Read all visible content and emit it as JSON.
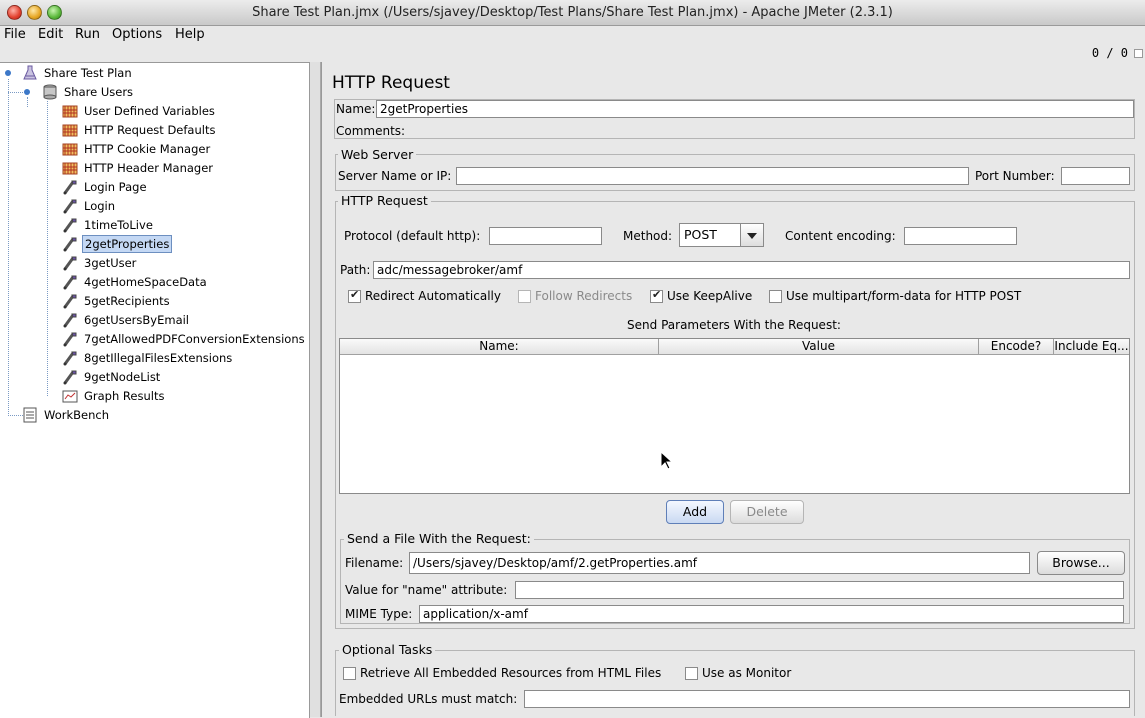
{
  "window": {
    "title": "Share Test Plan.jmx (/Users/sjavey/Desktop/Test Plans/Share Test Plan.jmx) - Apache JMeter (2.3.1)"
  },
  "menu": [
    "File",
    "Edit",
    "Run",
    "Options",
    "Help"
  ],
  "status": {
    "counter": "0 / 0"
  },
  "tree": {
    "root": "Share Test Plan",
    "group": "Share Users",
    "items": [
      "User Defined Variables",
      "HTTP Request Defaults",
      "HTTP Cookie Manager",
      "HTTP Header Manager",
      "Login Page",
      "Login",
      "1timeToLive",
      "2getProperties",
      "3getUser",
      "4getHomeSpaceData",
      "5getRecipients",
      "6getUsersByEmail",
      "7getAllowedPDFConversionExtensions",
      "8getIllegalFilesExtensions",
      "9getNodeList",
      "Graph Results"
    ],
    "workbench": "WorkBench",
    "selected": "2getProperties"
  },
  "panel": {
    "title": "HTTP Request",
    "name_label": "Name:",
    "name_value": "2getProperties",
    "comments_label": "Comments:",
    "web_server": {
      "legend": "Web Server",
      "server_label": "Server Name or IP:",
      "server_value": "",
      "port_label": "Port Number:",
      "port_value": ""
    },
    "http_request": {
      "legend": "HTTP Request",
      "protocol_label": "Protocol (default http):",
      "protocol_value": "",
      "method_label": "Method:",
      "method_value": "POST",
      "encoding_label": "Content encoding:",
      "encoding_value": "",
      "path_label": "Path:",
      "path_value": "adc/messagebroker/amf",
      "options": {
        "redirect": "Redirect Automatically",
        "follow": "Follow Redirects",
        "keepalive": "Use KeepAlive",
        "multipart": "Use multipart/form-data for HTTP POST"
      },
      "params_title": "Send Parameters With the Request:",
      "columns": [
        "Name:",
        "Value",
        "Encode?",
        "Include Eq..."
      ],
      "add_label": "Add",
      "delete_label": "Delete"
    },
    "file": {
      "legend": "Send a File With the Request:",
      "filename_label": "Filename:",
      "filename_value": "/Users/sjavey/Desktop/amf/2.getProperties.amf",
      "browse_label": "Browse...",
      "name_attr_label": "Value for \"name\" attribute:",
      "name_attr_value": "",
      "mime_label": "MIME Type:",
      "mime_value": "application/x-amf"
    },
    "optional": {
      "legend": "Optional Tasks",
      "retrieve_label": "Retrieve All Embedded Resources from HTML Files",
      "monitor_label": "Use as Monitor",
      "embedded_label": "Embedded URLs must match:",
      "embedded_value": ""
    }
  }
}
